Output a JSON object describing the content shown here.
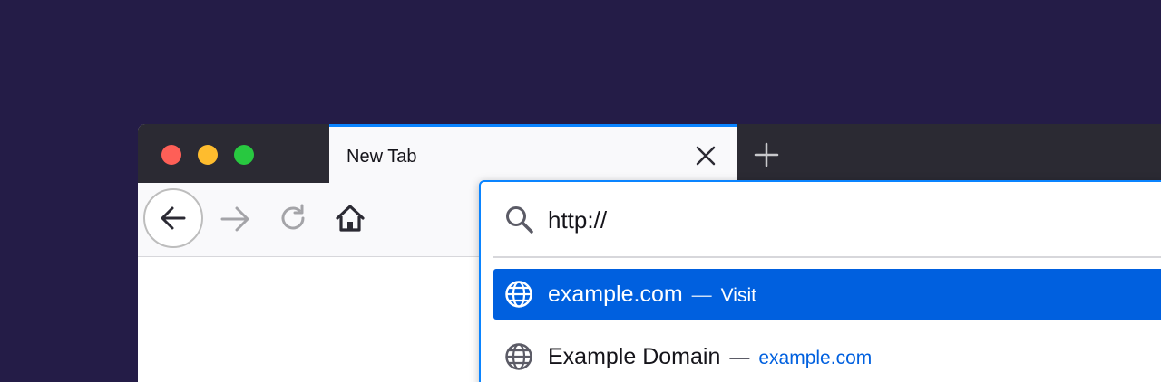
{
  "tab": {
    "title": "New Tab",
    "close_icon": "close-icon"
  },
  "toolbar": {
    "new_tab_icon": "plus-icon",
    "back_icon": "arrow-left-icon",
    "forward_icon": "arrow-right-icon",
    "reload_icon": "reload-icon",
    "home_icon": "home-icon"
  },
  "urlbar": {
    "value": "http://",
    "search_icon": "search-icon"
  },
  "results": [
    {
      "title": "example.com",
      "dash": "—",
      "action": "Visit",
      "icon": "globe-icon",
      "selected": true
    },
    {
      "title": "Example Domain",
      "dash": "—",
      "action": "example.com",
      "icon": "globe-icon",
      "selected": false
    }
  ],
  "colors": {
    "background": "#241c47",
    "titlebar": "#2b2a33",
    "accent": "#0a84ff",
    "selected_row": "#0060df",
    "traffic_red": "#fe5f57",
    "traffic_yellow": "#febc2e",
    "traffic_green": "#28c840"
  }
}
